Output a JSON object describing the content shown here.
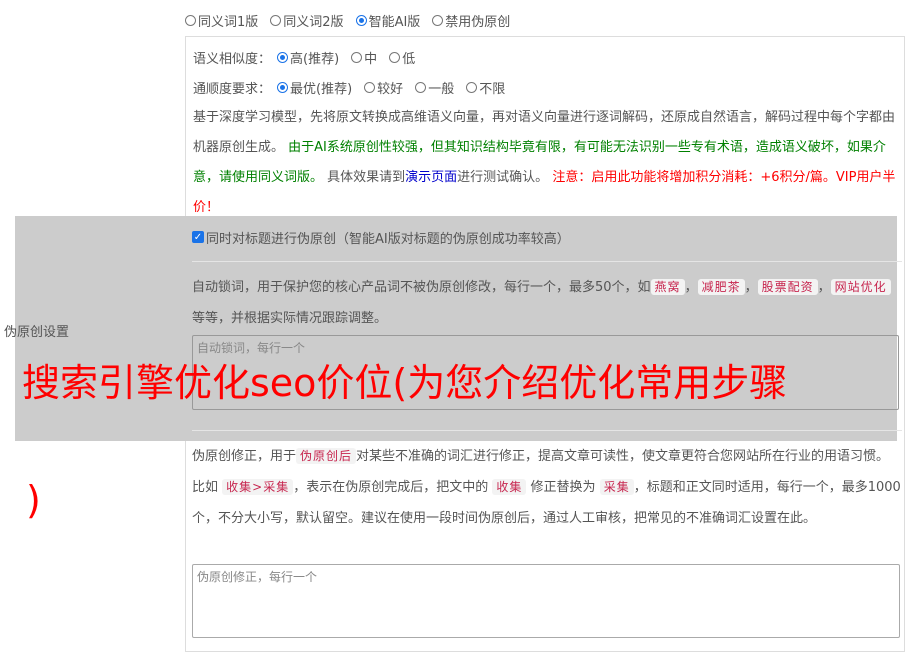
{
  "mode": {
    "options": [
      "同义词1版",
      "同义词2版",
      "智能AI版",
      "禁用伪原创"
    ],
    "selected_index": 2
  },
  "similarity": {
    "label": "语义相似度：",
    "options": [
      "高(推荐)",
      "中",
      "低"
    ],
    "selected_index": 0
  },
  "fluency": {
    "label": "通顺度要求：",
    "options": [
      "最优(推荐)",
      "较好",
      "一般",
      "不限"
    ],
    "selected_index": 0
  },
  "description": {
    "part1": "基于深度学习模型，先将原文转换成高维语义向量，再对语义向量进行逐词解码，还原成自然语言，解码过程中每个字都由机器原创生成。 ",
    "part2_green": "由于AI系统原创性较强，但其知识结构毕竟有限，有可能无法识别一些专有术语，造成语义破坏，如果介意，请使用同义词版。",
    "part3": " 具体效果请到",
    "part4_link": "演示页面",
    "part5": "进行测试确认。 ",
    "part6_red": "注意：启用此功能将增加积分消耗：+6积分/篇。VIP用户半价！"
  },
  "side_label": "伪原创设置",
  "title_option": {
    "checked": true,
    "label": "同时对标题进行伪原创（智能AI版对标题的伪原创成功率较高）"
  },
  "lock_words": {
    "desc_a": "自动锁词，用于保护您的核心产品词不被伪原创修改，每行一个，最多50个，如",
    "examples": [
      "燕窝",
      "减肥茶",
      "股票配资",
      "网站优化"
    ],
    "desc_b": "等等，并根据实际情况跟踪调整。",
    "placeholder": "自动锁词，每行一个"
  },
  "correction": {
    "desc_a": "伪原创修正，用于",
    "tag1": "伪原创后",
    "desc_b": "对某些不准确的词汇进行修正，提高文章可读性，使文章更符合您网站所在行业的用语习惯。比如",
    "tag2": "收集>采集",
    "desc_c": "，表示在伪原创完成后，把文中的",
    "tag3": "收集",
    "desc_d": "修正替换为",
    "tag4": "采集",
    "desc_e": "，标题和正文同时适用，每行一个，最多1000个，不分大小写，默认留空。建议在使用一段时间伪原创后，通过人工审核，把常见的不准确词汇设置在此。",
    "placeholder": "伪原创修正，每行一个"
  },
  "overlay": {
    "headline": "搜索引擎优化seo价位(为您介绍优化常用步骤",
    "tail": ")"
  },
  "colors": {
    "accent": "#1a73e8",
    "green": "#008000",
    "red": "#ff0000",
    "link": "#0000cc",
    "overlay_band": "#cccccc"
  }
}
